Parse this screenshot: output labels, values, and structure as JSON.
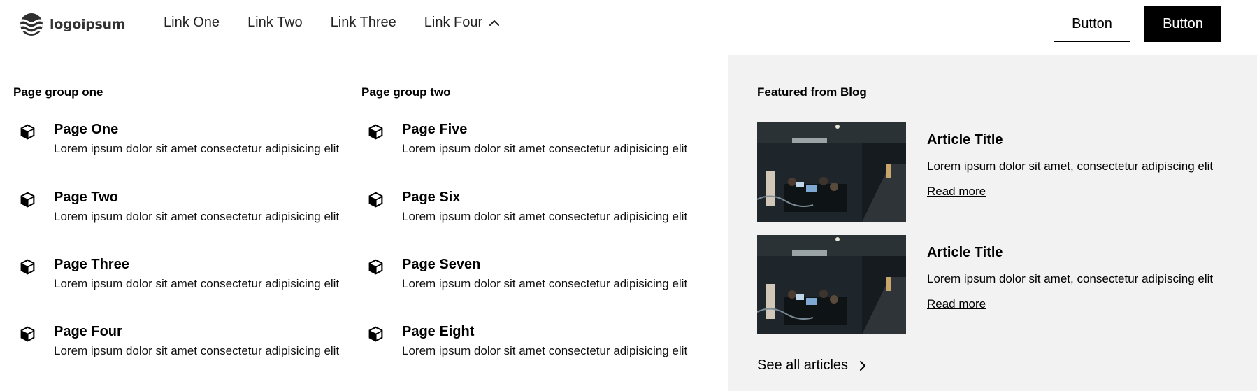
{
  "header": {
    "logo_text": "logoipsum",
    "nav_links": [
      "Link One",
      "Link Two",
      "Link Three",
      "Link Four"
    ],
    "open_link_icon": "chevron-up-icon",
    "buttons": {
      "secondary_label": "Button",
      "primary_label": "Button"
    }
  },
  "menu": {
    "group_one": {
      "title": "Page group one",
      "items": [
        {
          "title": "Page One",
          "desc": "Lorem ipsum dolor sit amet consectetur adipisicing elit",
          "icon": "cube-icon"
        },
        {
          "title": "Page Two",
          "desc": "Lorem ipsum dolor sit amet consectetur adipisicing elit",
          "icon": "cube-icon"
        },
        {
          "title": "Page Three",
          "desc": "Lorem ipsum dolor sit amet consectetur adipisicing elit",
          "icon": "cube-icon"
        },
        {
          "title": "Page Four",
          "desc": "Lorem ipsum dolor sit amet consectetur adipisicing elit",
          "icon": "cube-icon"
        }
      ]
    },
    "group_two": {
      "title": "Page group two",
      "items": [
        {
          "title": "Page Five",
          "desc": "Lorem ipsum dolor sit amet consectetur adipisicing elit",
          "icon": "cube-icon"
        },
        {
          "title": "Page Six",
          "desc": "Lorem ipsum dolor sit amet consectetur adipisicing elit",
          "icon": "cube-icon"
        },
        {
          "title": "Page Seven",
          "desc": "Lorem ipsum dolor sit amet consectetur adipisicing elit",
          "icon": "cube-icon"
        },
        {
          "title": "Page Eight",
          "desc": "Lorem ipsum dolor sit amet consectetur adipisicing elit",
          "icon": "cube-icon"
        }
      ]
    },
    "blog": {
      "title": "Featured from Blog",
      "articles": [
        {
          "title": "Article Title",
          "desc": "Lorem ipsum dolor sit amet, consectetur adipiscing elit",
          "link": "Read more"
        },
        {
          "title": "Article Title",
          "desc": "Lorem ipsum dolor sit amet, consectetur adipiscing elit",
          "link": "Read more"
        }
      ],
      "see_all": "See all articles",
      "see_all_icon": "chevron-right-icon"
    }
  },
  "colors": {
    "panel_bg": "#f2f2f2",
    "primary_button_bg": "#000000",
    "text": "#000000"
  }
}
